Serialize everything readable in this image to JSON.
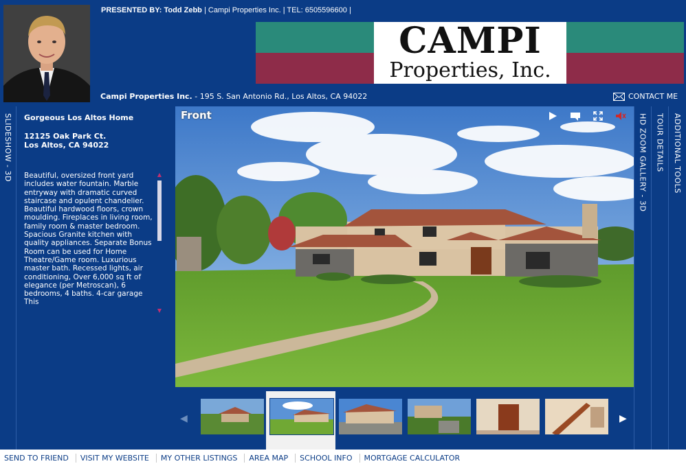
{
  "header": {
    "presented_label": "PRESENTED BY:",
    "agent_name": "Todd Zebb",
    "company_text": "Campi Properties Inc.",
    "tel_text": "TEL: 6505596600",
    "separator": "|",
    "logo_line1": "CAMPI",
    "logo_line2": "Properties, Inc.",
    "address_company": "Campi Properties Inc.",
    "address_text": "- 195 S. San Antonio Rd., Los Altos, CA 94022",
    "contact_label": "CONTACT ME",
    "colors": {
      "teal": "#2a8a7a",
      "maroon": "#8e2c49",
      "background": "#0b3c86"
    }
  },
  "side_tabs": {
    "slideshow": "SLIDESHOW - 3D",
    "hd_zoom": "HD ZOOM GALLERY - 3D",
    "tour_details": "TOUR DETAILS",
    "additional_tools": "ADDITIONAL TOOLS"
  },
  "listing": {
    "title": "Gorgeous Los Altos Home",
    "address_line1": "12125 Oak Park Ct.",
    "address_line2": "Los Altos, CA 94022",
    "description": "Beautiful, oversized front yard includes water fountain. Marble entryway with dramatic curved staircase and opulent chandelier. Beautiful hardwood floors, crown moulding. Fireplaces in living room, family room & master bedroom. Spacious Granite kitchen with quality appliances. Separate Bonus Room can be used for Home Theatre/Game room. Luxurious master bath. Recessed lights, air conditioning, Over 6,000 sq ft of elegance (per Metroscan), 6 bedrooms, 4 baths. 4-car garage This"
  },
  "viewer": {
    "image_title": "Front",
    "controls": [
      "play-icon",
      "comment-icon",
      "fullscreen-icon",
      "sound-icon"
    ]
  },
  "thumbnails": [
    {
      "name": "aerial-view"
    },
    {
      "name": "front",
      "active": true
    },
    {
      "name": "side-view"
    },
    {
      "name": "garden"
    },
    {
      "name": "entry-doors"
    },
    {
      "name": "staircase"
    }
  ],
  "footer": {
    "links": [
      "SEND TO FRIEND",
      "VISIT MY WEBSITE",
      "MY OTHER LISTINGS",
      "AREA MAP",
      "SCHOOL INFO",
      "MORTGAGE CALCULATOR"
    ]
  }
}
